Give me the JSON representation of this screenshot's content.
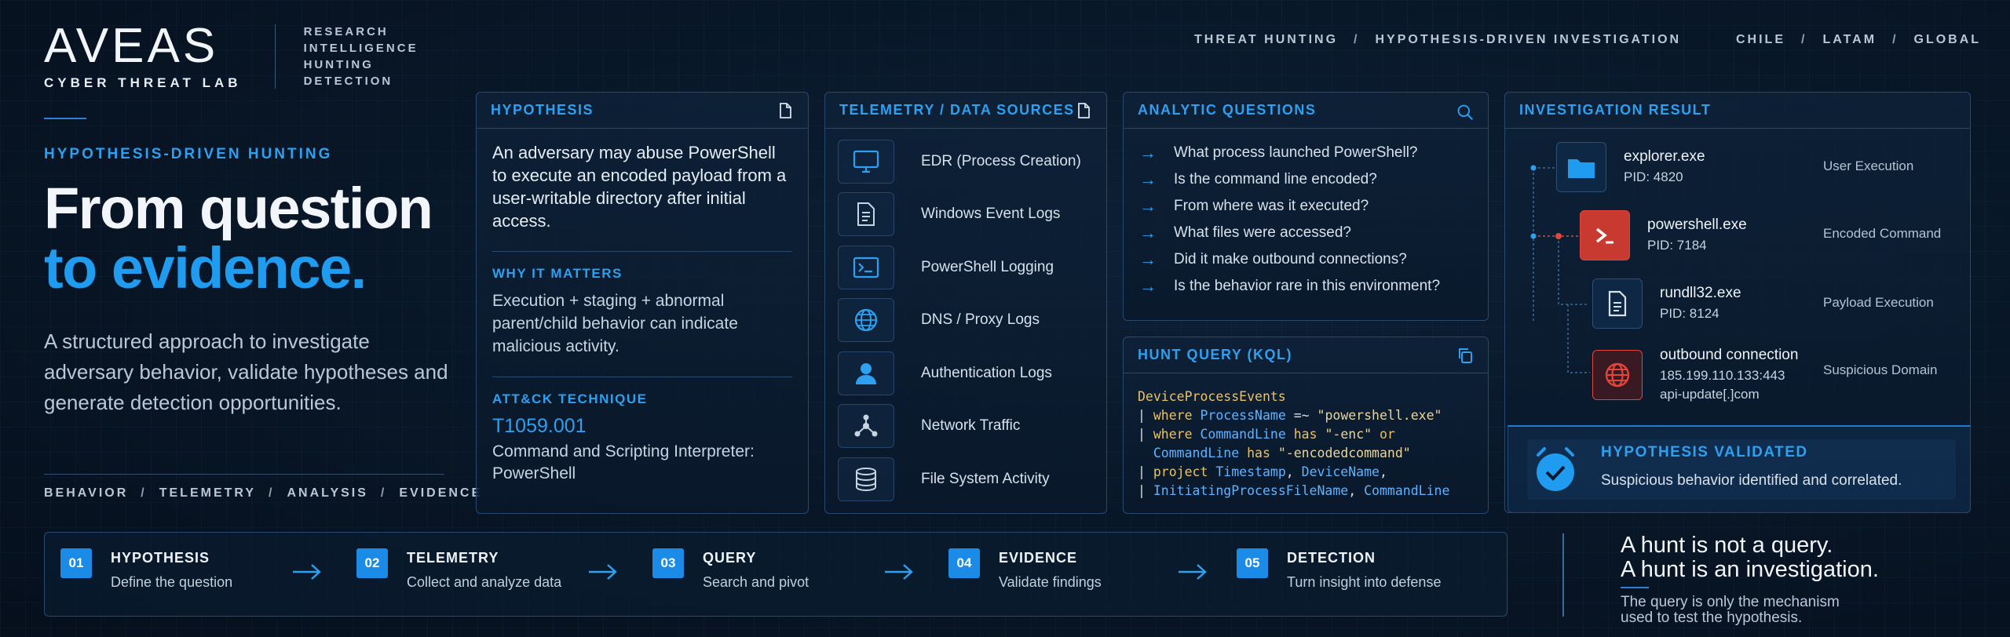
{
  "brand": {
    "name": "AVEAS",
    "subtitle": "CYBER THREAT LAB",
    "tags": [
      "RESEARCH",
      "INTELLIGENCE",
      "HUNTING",
      "DETECTION"
    ]
  },
  "top_nav_left": [
    "THREAT HUNTING",
    "HYPOTHESIS-DRIVEN INVESTIGATION"
  ],
  "top_nav_right": [
    "CHILE",
    "LATAM",
    "GLOBAL"
  ],
  "hero": {
    "kicker": "HYPOTHESIS-DRIVEN HUNTING",
    "title_line1": "From question",
    "title_line2": "to evidence.",
    "description": "A structured approach to investigate adversary behavior, validate hypotheses and generate detection opportunities.",
    "bottom_tags": [
      "BEHAVIOR",
      "TELEMETRY",
      "ANALYSIS",
      "EVIDENCE"
    ]
  },
  "hypothesis_card": {
    "title": "HYPOTHESIS",
    "text": "An adversary may abuse PowerShell to execute an encoded payload from a user-writable directory after initial access.",
    "why_title": "WHY IT MATTERS",
    "why_text": "Execution + staging + abnormal parent/child behavior can indicate malicious activity.",
    "technique_title": "ATT&CK TECHNIQUE",
    "technique_id": "T1059.001",
    "technique_desc": "Command and Scripting Interpreter: PowerShell"
  },
  "telemetry_card": {
    "title": "TELEMETRY / DATA SOURCES",
    "items": [
      {
        "label": "EDR (Process Creation)",
        "icon": "monitor-icon"
      },
      {
        "label": "Windows Event Logs",
        "icon": "document-icon"
      },
      {
        "label": "PowerShell Logging",
        "icon": "terminal-icon"
      },
      {
        "label": "DNS / Proxy Logs",
        "icon": "globe-icon"
      },
      {
        "label": "Authentication Logs",
        "icon": "user-icon"
      },
      {
        "label": "Network Traffic",
        "icon": "network-icon"
      },
      {
        "label": "File System Activity",
        "icon": "database-icon"
      }
    ]
  },
  "analytic_card": {
    "title": "ANALYTIC QUESTIONS",
    "questions": [
      "What process launched PowerShell?",
      "Is the command line encoded?",
      "From where was it executed?",
      "What files were accessed?",
      "Did it make outbound connections?",
      "Is the behavior rare in this environment?"
    ]
  },
  "query_card": {
    "title": "HUNT QUERY (KQL)",
    "lines": [
      "DeviceProcessEvents",
      "| where ProcessName =~ \"powershell.exe\"",
      "| where CommandLine has \"-enc\" or",
      "  CommandLine has \"-encodedcommand\"",
      "| project Timestamp, DeviceName,",
      "| InitiatingProcessFileName, CommandLine"
    ]
  },
  "investigation_card": {
    "title": "INVESTIGATION RESULT",
    "nodes": [
      {
        "name": "explorer.exe",
        "sub": "PID: 4820",
        "tag": "User Execution",
        "icon": "folder-icon"
      },
      {
        "name": "powershell.exe",
        "sub": "PID: 7184",
        "tag": "Encoded Command",
        "icon": "powershell-icon"
      },
      {
        "name": "rundll32.exe",
        "sub": "PID: 8124",
        "tag": "Payload Execution",
        "icon": "file-icon"
      },
      {
        "name": "outbound connection",
        "sub": "185.199.110.133:443",
        "sub2": "api-update[.]com",
        "tag": "Suspicious Domain",
        "icon": "globe-icon"
      }
    ],
    "validated_title": "HYPOTHESIS VALIDATED",
    "validated_text": "Suspicious behavior identified and correlated."
  },
  "steps": [
    {
      "num": "01",
      "title": "HYPOTHESIS",
      "sub": "Define the question"
    },
    {
      "num": "02",
      "title": "TELEMETRY",
      "sub": "Collect and analyze data"
    },
    {
      "num": "03",
      "title": "QUERY",
      "sub": "Search and pivot"
    },
    {
      "num": "04",
      "title": "EVIDENCE",
      "sub": "Validate findings"
    },
    {
      "num": "05",
      "title": "DETECTION",
      "sub": "Turn insight into defense"
    }
  ],
  "quote": {
    "line1": "A hunt is not a query.",
    "line2": "A hunt is an investigation.",
    "sub1": "The query is only the mechanism",
    "sub2": "used to test the hypothesis."
  },
  "colors": {
    "accent": "#1f9cf0",
    "alert": "#e2463a"
  }
}
